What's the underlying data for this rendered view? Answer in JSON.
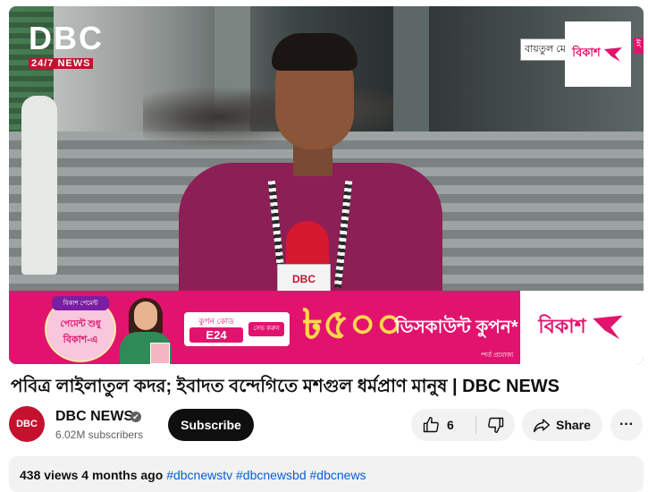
{
  "video": {
    "logo_main": "DBC",
    "logo_sub": "24/7 NEWS",
    "lower_third_label": "বায়তুল মো",
    "sponsor_logo_text": "বিকাশ",
    "mic_label": "DBC",
    "ad": {
      "badge": "বিকাশ পেমেন্ট",
      "headline_line1": "পেমেন্ট শুধু",
      "headline_line2": "বিকাশ-এ",
      "coupon_label": "কুপন কোড",
      "coupon_code": "E24",
      "coupon_cta": "সেভ করুন",
      "amount": "৳৫০০",
      "discount_text": "ডিসকাউন্ট কুপন*",
      "conditions": "*শর্ত প্রযোজ্য",
      "brand": "বিকাশ"
    }
  },
  "title": "পবিত্র লাইলাতুল কদর; ইবাদত বন্দেগিতে মশগুল ধর্মপ্রাণ মানুষ | DBC NEWS",
  "channel": {
    "avatar_text": "DBC",
    "name": "DBC NEWS",
    "verified_icon": "✔",
    "subscribers": "6.02M subscribers",
    "subscribe_label": "Subscribe"
  },
  "actions": {
    "like_count": "6",
    "share_label": "Share",
    "more_label": "···"
  },
  "description": {
    "views": "438 views",
    "age": "4 months ago",
    "hashtags": "#dbcnewstv #dbcnewsbd #dbcnews"
  }
}
